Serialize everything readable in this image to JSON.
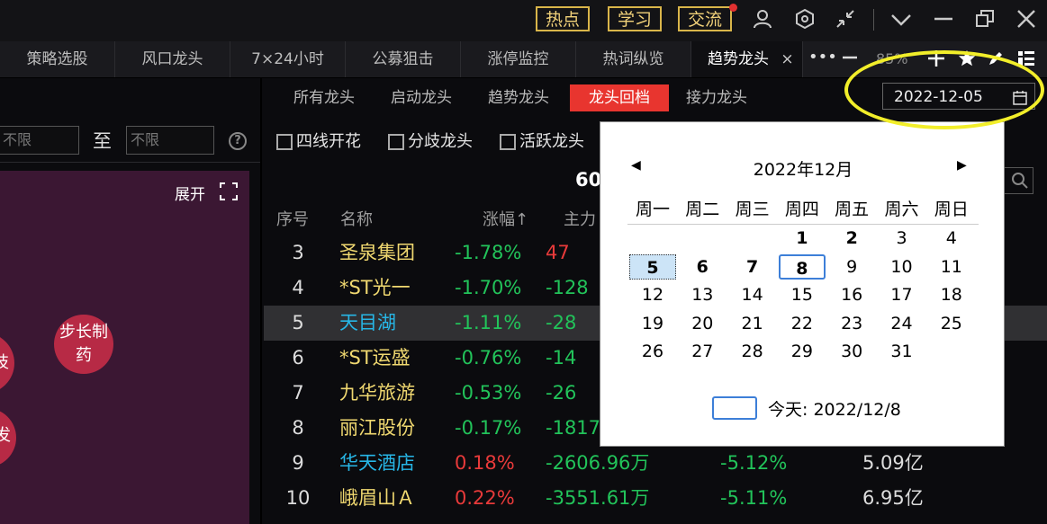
{
  "topbar": {
    "buttons": [
      "热点",
      "学习",
      "交流"
    ]
  },
  "tabs": [
    {
      "label": "策略选股"
    },
    {
      "label": "风口龙头"
    },
    {
      "label": "7×24小时"
    },
    {
      "label": "公募狙击"
    },
    {
      "label": "涨停监控"
    },
    {
      "label": "热词纵览"
    },
    {
      "label": "趋势龙头",
      "active": true,
      "close": "×"
    }
  ],
  "tab_tools": {
    "more": "•••",
    "zoom": "85%"
  },
  "subtabs": [
    "所有龙头",
    "启动龙头",
    "趋势龙头",
    "龙头回档",
    "接力龙头"
  ],
  "date_input": {
    "value": "2022-12-05"
  },
  "left": {
    "range_from": "不限",
    "range_sep": "至",
    "range_to": "不限",
    "help": "?",
    "expand": "展开",
    "bubbles": [
      "步长制药",
      "技",
      "发"
    ]
  },
  "filters": [
    "四线开花",
    "分歧龙头",
    "活跃龙头"
  ],
  "table": {
    "count_partial": "60",
    "headers": {
      "seq": "序号",
      "name": "名称",
      "change": "涨幅↑",
      "main": "主力"
    },
    "rows": [
      {
        "seq": "3",
        "name": "圣泉集团",
        "change": "-1.78%",
        "main": "47",
        "c5": "",
        "c6": "",
        "name_color": "#f0d870",
        "main_color": "#e83a3a"
      },
      {
        "seq": "4",
        "name": "*ST光一",
        "change": "-1.70%",
        "main": "-128",
        "c5": "",
        "c6": "",
        "name_color": "#f0d870",
        "main_color": "#22c35a"
      },
      {
        "seq": "5",
        "name": "天目湖",
        "change": "-1.11%",
        "main": "-28",
        "c5": "",
        "c6": "",
        "name_color": "#27b6e6",
        "main_color": "#22c35a",
        "selected": true
      },
      {
        "seq": "6",
        "name": "*ST运盛",
        "change": "-0.76%",
        "main": "-14",
        "c5": "",
        "c6": "",
        "name_color": "#f0d870",
        "main_color": "#22c35a"
      },
      {
        "seq": "7",
        "name": "九华旅游",
        "change": "-0.53%",
        "main": "-26",
        "c5": "",
        "c6": "",
        "name_color": "#f0d870",
        "main_color": "#22c35a"
      },
      {
        "seq": "8",
        "name": "丽江股份",
        "change": "-0.17%",
        "main": "-1817",
        "c5": "",
        "c6": "",
        "name_color": "#f0d870",
        "main_color": "#22c35a"
      },
      {
        "seq": "9",
        "name": "华天酒店",
        "change": "0.18%",
        "main": "-2606.96万",
        "c5": "-5.12%",
        "c6": "5.09亿",
        "name_color": "#27b6e6",
        "main_color": "#22c35a"
      },
      {
        "seq": "10",
        "name": "峨眉山Ａ",
        "change": "0.22%",
        "main": "-3551.61万",
        "c5": "-5.11%",
        "c6": "6.95亿",
        "name_color": "#f0d870",
        "main_color": "#22c35a"
      }
    ]
  },
  "calendar": {
    "prev": "◀",
    "title": "2022年12月",
    "next": "▶",
    "weekdays": [
      "周一",
      "周二",
      "周三",
      "周四",
      "周五",
      "周六",
      "周日"
    ],
    "today_label": "今天: 2022/12/8",
    "selected_day": 5,
    "today_day": 8,
    "bold_days": [
      1,
      2,
      5,
      6,
      7,
      8
    ]
  }
}
